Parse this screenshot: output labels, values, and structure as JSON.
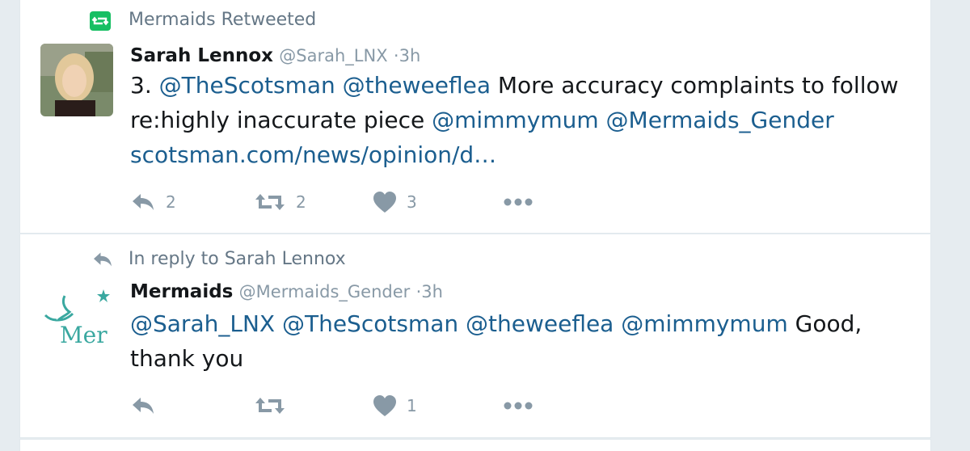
{
  "colors": {
    "link": "#1b5e8f",
    "muted": "#8899a6",
    "retweet_green": "#17bf63",
    "background": "#e6ecf0"
  },
  "tweets": [
    {
      "context": {
        "icon": "retweet-icon",
        "text": "Mermaids Retweeted"
      },
      "author": {
        "name": "Sarah Lennox",
        "handle": "@Sarah_LNX",
        "separator": "·",
        "time": "3h"
      },
      "text": {
        "prefix": "3. ",
        "mention_1": "@TheScotsman",
        "space_1": " ",
        "mention_2": "@theweeflea",
        "body": " More accuracy complaints to follow re:highly inaccurate piece ",
        "mention_3": "@mimmymum",
        "space_2": " ",
        "mention_4": "@Mermaids_Gender",
        "space_3": " ",
        "url": "scotsman.com/news/opinion/d…"
      },
      "actions": {
        "reply_count": "2",
        "retweet_count": "2",
        "like_count": "3"
      }
    },
    {
      "context": {
        "icon": "reply-icon",
        "text": "In reply to Sarah Lennox"
      },
      "author": {
        "name": "Mermaids",
        "handle": "@Mermaids_Gender",
        "separator": "·",
        "time": "3h"
      },
      "text": {
        "mention_1": "@Sarah_LNX",
        "space_1": " ",
        "mention_2": "@TheScotsman",
        "space_2": " ",
        "mention_3": "@theweeflea",
        "space_3": " ",
        "mention_4": "@mimmymum",
        "body": " Good, thank you"
      },
      "avatar_text": "Mer",
      "actions": {
        "reply_count": "",
        "retweet_count": "",
        "like_count": "1"
      }
    }
  ]
}
